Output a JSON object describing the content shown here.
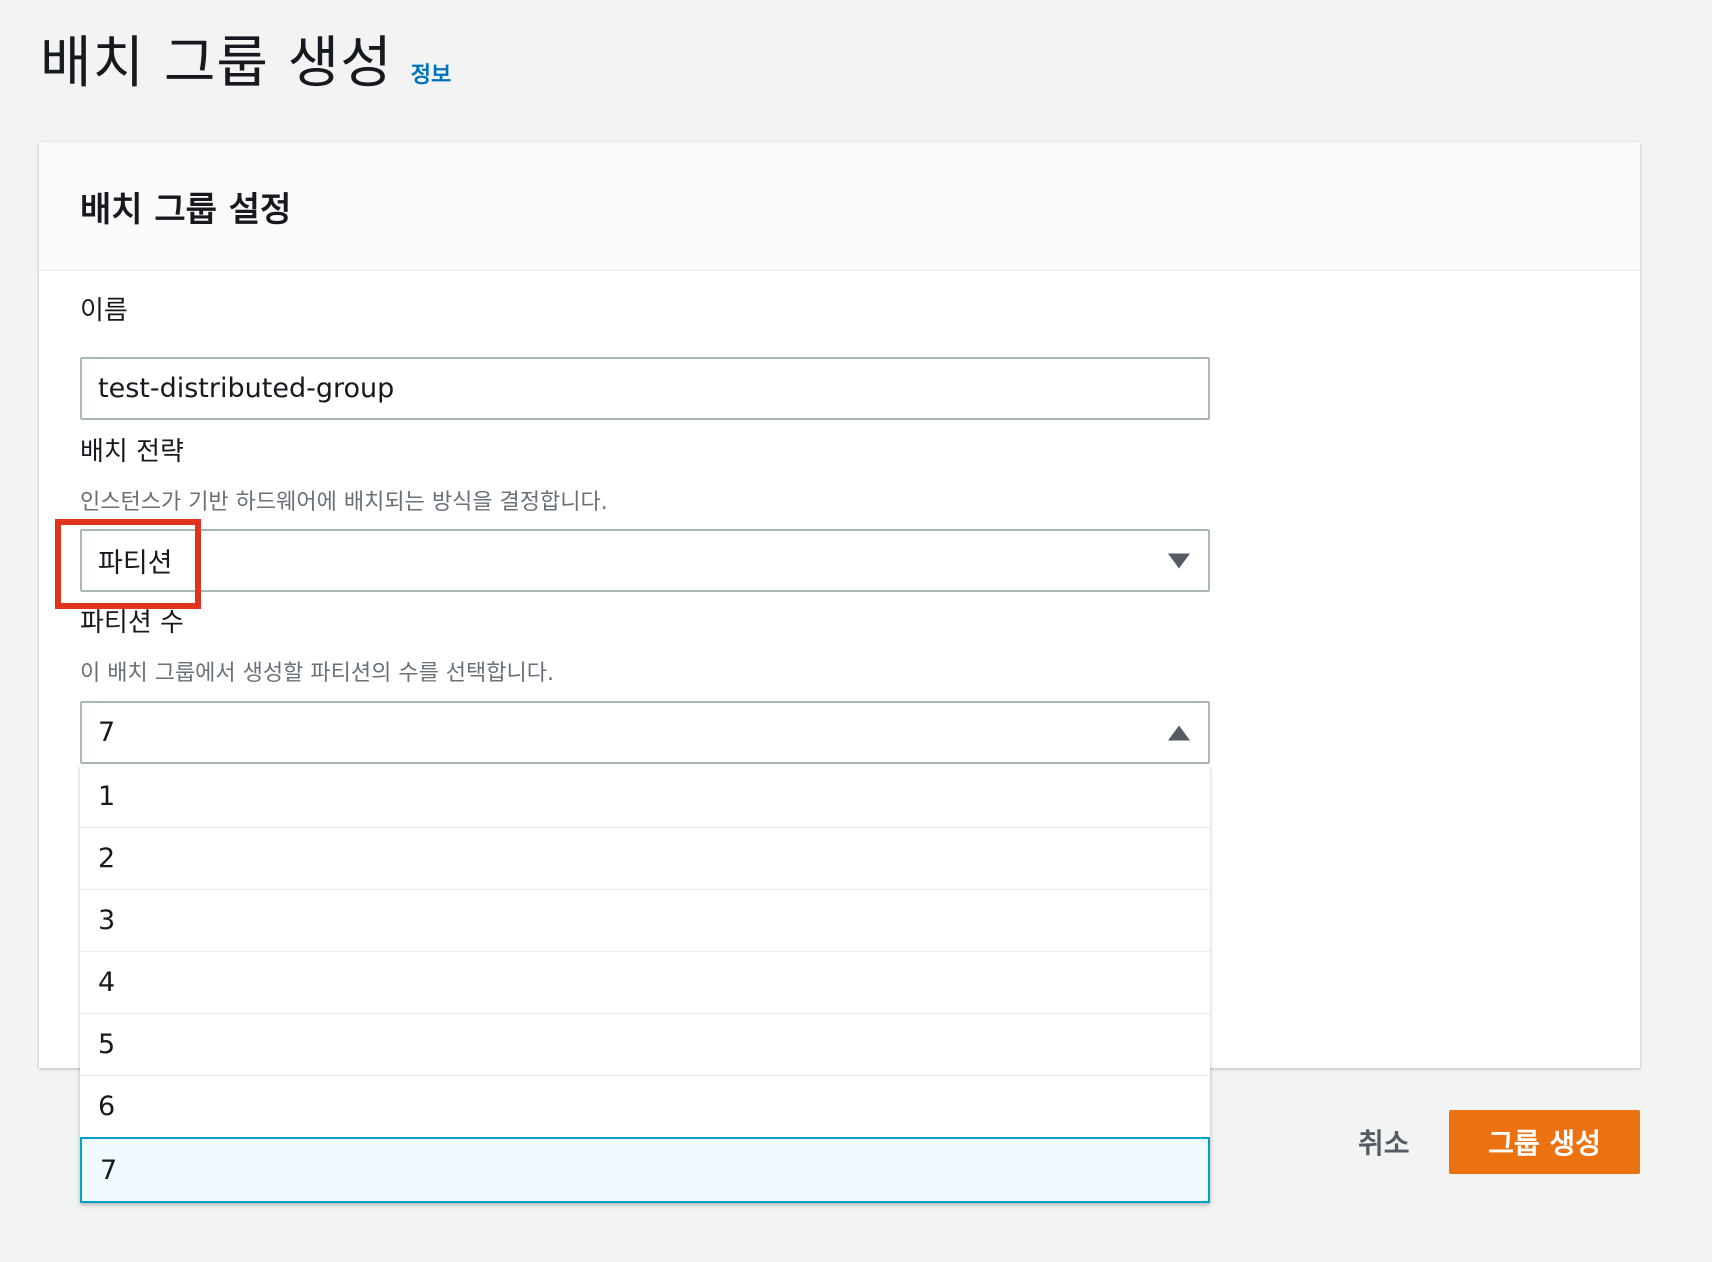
{
  "page": {
    "title": "배치 그룹 생성",
    "info_link": "정보"
  },
  "panel": {
    "title": "배치 그룹 설정"
  },
  "name_field": {
    "label": "이름",
    "value": "test-distributed-group"
  },
  "strategy_field": {
    "label": "배치 전략",
    "description": "인스턴스가 기반 하드웨어에 배치되는 방식을 결정합니다.",
    "selected": "파티션"
  },
  "partition_count_field": {
    "label": "파티션 수",
    "description": "이 배치 그룹에서 생성할 파티션의 수를 선택합니다.",
    "selected": "7",
    "options": [
      "1",
      "2",
      "3",
      "4",
      "5",
      "6",
      "7"
    ]
  },
  "actions": {
    "cancel_label": "취소",
    "create_label": "그룹 생성"
  },
  "colors": {
    "primary_button": "#ec7211",
    "link": "#0073bb",
    "highlight_annotation": "#e1341e",
    "selected_option_bg": "#f1faff",
    "selected_option_border": "#00a1c9"
  },
  "icons": {
    "strategy_caret": "caret-down-icon",
    "partition_caret": "caret-up-icon"
  }
}
